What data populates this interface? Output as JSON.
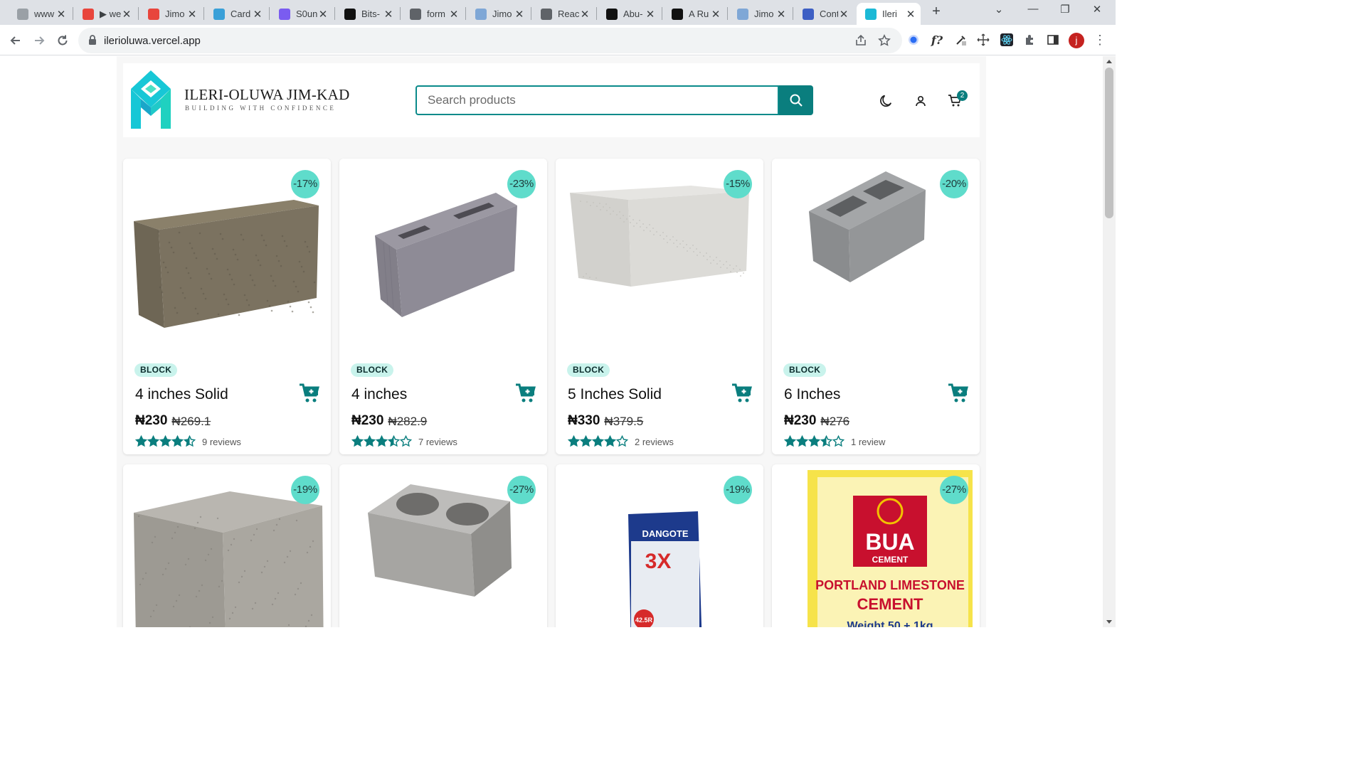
{
  "browser": {
    "tabs": [
      {
        "title": "www",
        "color": "#9aa0a6"
      },
      {
        "title": "▶ we",
        "color": "#e8453c"
      },
      {
        "title": "Jimo",
        "color": "#e8453c"
      },
      {
        "title": "Card",
        "color": "#3aa0d8"
      },
      {
        "title": "S0un",
        "color": "#7a5cf0"
      },
      {
        "title": "Bits-",
        "color": "#111111"
      },
      {
        "title": "form",
        "color": "#5f6368"
      },
      {
        "title": "Jimo",
        "color": "#7fa7d6"
      },
      {
        "title": "Reac",
        "color": "#5f6368"
      },
      {
        "title": "Abu-",
        "color": "#111111"
      },
      {
        "title": "A Ru",
        "color": "#111111"
      },
      {
        "title": "Jimo",
        "color": "#7fa7d6"
      },
      {
        "title": "Cont",
        "color": "#3d5fc4"
      },
      {
        "title": "Ileri",
        "color": "#1cb9d6"
      }
    ],
    "url": "ilerioluwa.vercel.app",
    "profile_initial": "j",
    "ext_f_label": "f?"
  },
  "site": {
    "brand": {
      "name": "ILERI-OLUWA JIM-KAD",
      "tagline": "BUILDING WITH CONFIDENCE",
      "colors": {
        "primary": "#1cb9d6",
        "accent": "#17d3c4"
      }
    },
    "search": {
      "placeholder": "Search products",
      "value": ""
    },
    "cart_count": "2",
    "accent_color": "#0a7e7e",
    "badge_color": "#5fdccb"
  },
  "products": [
    {
      "discount": "-17%",
      "category": "BLOCK",
      "name": "4 inches Solid",
      "price": "₦230",
      "old_price": "₦269.1",
      "rating": 4.5,
      "reviews": "9 reviews",
      "image": "solid-block-brown"
    },
    {
      "discount": "-23%",
      "category": "BLOCK",
      "name": "4 inches",
      "price": "₦230",
      "old_price": "₦282.9",
      "rating": 3.5,
      "reviews": "7 reviews",
      "image": "hollow-block-4"
    },
    {
      "discount": "-15%",
      "category": "BLOCK",
      "name": "5 Inches Solid",
      "price": "₦330",
      "old_price": "₦379.5",
      "rating": 4,
      "reviews": "2 reviews",
      "image": "solid-block-white"
    },
    {
      "discount": "-20%",
      "category": "BLOCK",
      "name": "6 Inches",
      "price": "₦230",
      "old_price": "₦276",
      "rating": 3.5,
      "reviews": "1 review",
      "image": "hollow-block-6"
    },
    {
      "discount": "-19%",
      "image": "solid-block-grey"
    },
    {
      "discount": "-27%",
      "image": "hollow-block-9"
    },
    {
      "discount": "-19%",
      "image": "dangote-cement-bag"
    },
    {
      "discount": "-27%",
      "image": "bua-cement-bag",
      "bag_text": {
        "brand": "BUA",
        "sub": "CEMENT",
        "line1": "PORTLAND LIMESTONE",
        "line2": "CEMENT",
        "weight": "Weight 50 + 1kg"
      },
      "dangote_text": {
        "brand": "DANGOTE",
        "mark": "3X",
        "grade": "42.5R"
      }
    }
  ]
}
